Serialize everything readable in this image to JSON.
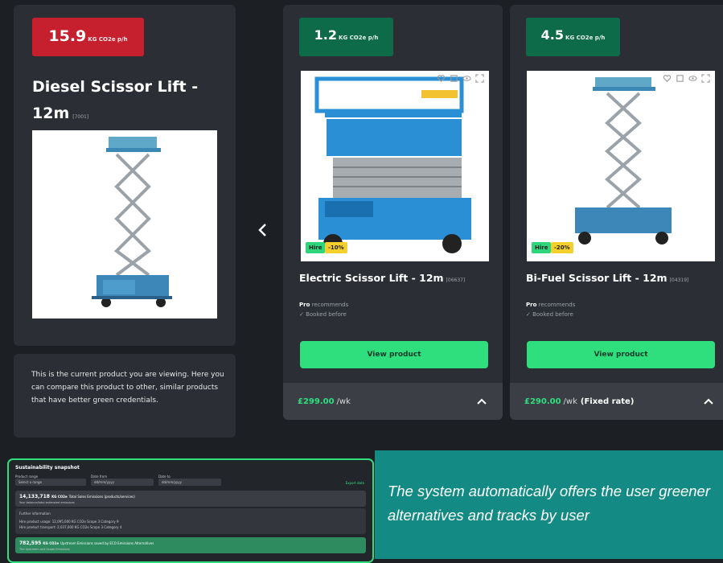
{
  "current": {
    "co2_value": "15.9",
    "co2_unit": "KG CO2e p/h",
    "title_line1": "Diesel Scissor Lift -",
    "title_line2": "12m",
    "code": "[7001]",
    "info_text": "This is the current product you are viewing. Here you can compare this product to other, similar products that have better green credentials."
  },
  "alternatives": [
    {
      "co2_value": "1.2",
      "co2_unit": "KG CO2e p/h",
      "title": "Electric Scissor Lift - 12m",
      "code": "[06637]",
      "tag_hire": "Hire",
      "tag_discount": "-10%",
      "rec_bold": "Pro",
      "rec_text": "recommends",
      "booked": "✓ Booked before",
      "button": "View product",
      "price": "£299.00",
      "per": "/wk",
      "suffix": ""
    },
    {
      "co2_value": "4.5",
      "co2_unit": "KG CO2e p/h",
      "title": "Bi-Fuel Scissor Lift - 12m",
      "code": "[04319]",
      "tag_hire": "Hire",
      "tag_discount": "-20%",
      "rec_bold": "Pro",
      "rec_text": "recommends",
      "booked": "✓ Booked before",
      "button": "View product",
      "price": "£290.00",
      "per": "/wk",
      "suffix": "(Fixed rate)"
    }
  ],
  "snapshot": {
    "title": "Sustainability snapshot",
    "filter1_label": "Product range",
    "filter1_value": "Select a range",
    "filter2_label": "Date from",
    "filter2_value": "dd/mm/yyyy",
    "filter3_label": "Date to",
    "filter3_value": "dd/mm/yyyy",
    "export": "Export data",
    "total_value": "14,133,718",
    "total_unit": "KG CO2e",
    "total_desc": "Total Sales Emissions (products/services)",
    "total_sub": "Your balance/total estimated emissions",
    "further": "Further information",
    "line1": "Hire product usage: 12,095,000 KG CO2e Scope 3 Category 9",
    "line2": "Hire product transport: 2,037,000 KG CO2e Scope 3 Category 4",
    "saved_value": "782,595",
    "saved_unit": "KG CO2e",
    "saved_desc": "Upstream Emissions saved by ECO Emissions Alternatives",
    "saved_sub": "The Upstream and Scope Emissions"
  },
  "caption": "The system automatically offers the user greener alternatives and tracks by user",
  "colors": {
    "red_badge": "#c6202f",
    "green_badge": "#0e6b4a",
    "button_green": "#2fdf7e",
    "teal_caption_bg": "#138b84"
  }
}
